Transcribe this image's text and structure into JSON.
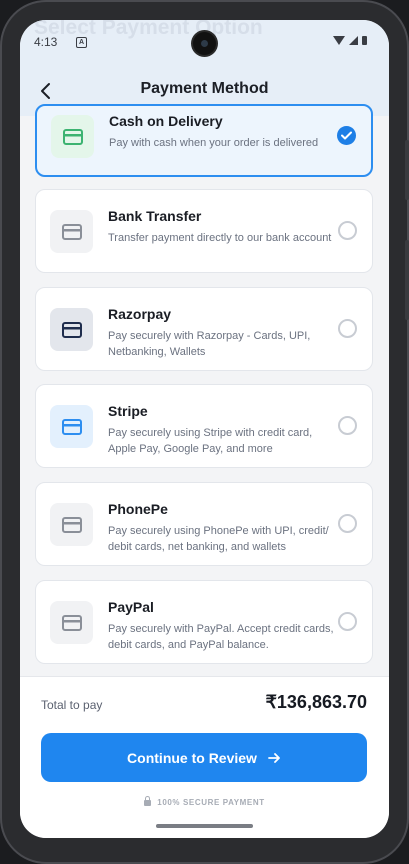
{
  "status_bar": {
    "time": "4:13",
    "notification_glyph": "A"
  },
  "ghost_title": "Select Payment Option",
  "header": {
    "title": "Payment Method"
  },
  "payment_methods": [
    {
      "title": "Cash on Delivery",
      "description": "Pay with cash when your order is delivered",
      "icon": "cash-card-icon",
      "icon_color": "#3cb371",
      "icon_bg": "#e4f6ea",
      "selected": true
    },
    {
      "title": "Bank Transfer",
      "description": "Transfer payment directly to our bank account",
      "icon": "bank-card-icon",
      "icon_color": "#8a8f98",
      "icon_bg": "#f1f2f4",
      "selected": false
    },
    {
      "title": "Razorpay",
      "description": "Pay securely with Razorpay - Cards, UPI, Netbanking, Wallets",
      "icon": "razorpay-card-icon",
      "icon_color": "#1f2d4d",
      "icon_bg": "#e3e6ec",
      "selected": false
    },
    {
      "title": "Stripe",
      "description": "Pay securely using Stripe with credit card, Apple Pay, Google Pay, and more",
      "icon": "stripe-card-icon",
      "icon_color": "#2d8ef0",
      "icon_bg": "#e3f0fd",
      "selected": false
    },
    {
      "title": "PhonePe",
      "description": "Pay securely using PhonePe with UPI, credit/ debit cards, net banking, and wallets",
      "icon": "phonepe-card-icon",
      "icon_color": "#8a8f98",
      "icon_bg": "#f1f2f4",
      "selected": false
    },
    {
      "title": "PayPal",
      "description": "Pay securely with PayPal. Accept credit cards, debit cards, and PayPal balance.",
      "icon": "paypal-card-icon",
      "icon_color": "#8a8f98",
      "icon_bg": "#f1f2f4",
      "selected": false
    }
  ],
  "summary": {
    "total_label": "Total to pay",
    "total_value": "₹136,863.70"
  },
  "continue_button": {
    "label": "Continue to Review"
  },
  "secure_note": "100% SECURE PAYMENT",
  "colors": {
    "accent": "#1f86ef",
    "selected_bg": "#edf5fd"
  }
}
